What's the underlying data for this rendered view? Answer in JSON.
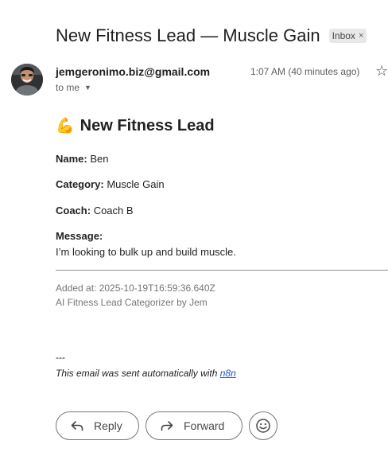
{
  "email": {
    "subject": "New Fitness Lead — Muscle Gain",
    "label_chip": "Inbox",
    "label_chip_close": "×",
    "sender": "jemgeronimo.biz@gmail.com",
    "recipient": "to me",
    "time": "1:07 AM (40 minutes ago)"
  },
  "message": {
    "emoji": "💪",
    "headline": "New Fitness Lead",
    "name_label": "Name:",
    "name_value": "Ben",
    "category_label": "Category:",
    "category_value": "Muscle Gain",
    "coach_label": "Coach:",
    "coach_value": "Coach B",
    "message_label": "Message:",
    "message_value": "I’m looking to bulk up and build muscle.",
    "added_at": "Added at: 2025-10-19T16:59:36.640Z",
    "categorizer": "AI Fitness Lead Categorizer by Jem",
    "separator": "---",
    "footer_text": "This email was sent automatically with ",
    "footer_link": "n8n"
  },
  "actions": {
    "reply_label": "Reply",
    "forward_label": "Forward"
  },
  "icons": {
    "star": "star-icon",
    "reply": "reply-arrow-icon",
    "forward": "forward-arrow-icon",
    "emoji": "smiley-icon"
  }
}
